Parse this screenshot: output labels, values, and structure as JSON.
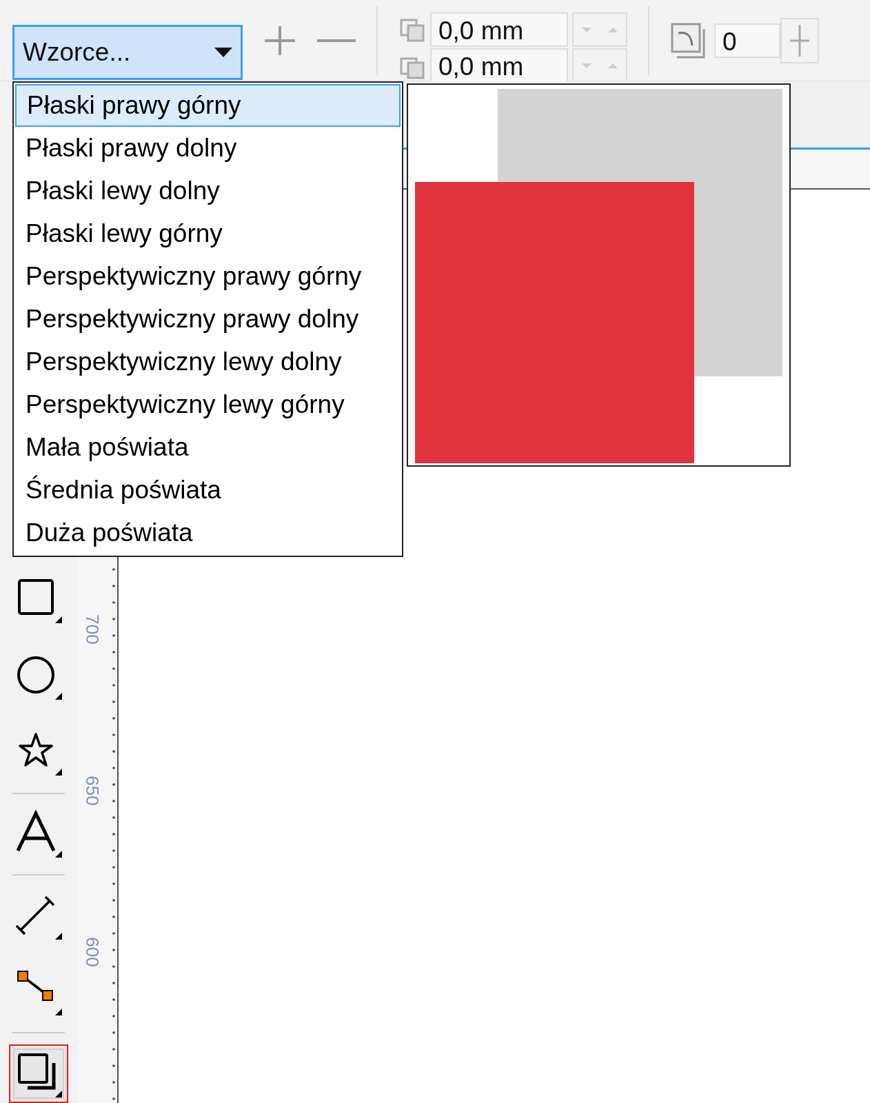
{
  "toolbar": {
    "preset_dropdown": {
      "label": "Wzorce..."
    },
    "offset_x": {
      "value": "0,0 mm"
    },
    "offset_y": {
      "value": "0,0 mm"
    },
    "angle": {
      "value": "0"
    }
  },
  "preset_list": [
    {
      "label": "Płaski prawy górny",
      "selected": true
    },
    {
      "label": "Płaski prawy dolny",
      "selected": false
    },
    {
      "label": "Płaski lewy dolny",
      "selected": false
    },
    {
      "label": "Płaski lewy górny",
      "selected": false
    },
    {
      "label": "Perspektywiczny prawy górny",
      "selected": false
    },
    {
      "label": "Perspektywiczny prawy dolny",
      "selected": false
    },
    {
      "label": "Perspektywiczny lewy dolny",
      "selected": false
    },
    {
      "label": "Perspektywiczny lewy górny",
      "selected": false
    },
    {
      "label": "Mała poświata",
      "selected": false
    },
    {
      "label": "Średnia poświata",
      "selected": false
    },
    {
      "label": "Duża poświata",
      "selected": false
    }
  ],
  "toolbox": [
    {
      "kind": "rectangle",
      "selected": false
    },
    {
      "kind": "ellipse",
      "selected": false
    },
    {
      "kind": "star",
      "selected": false
    },
    {
      "kind": "separator"
    },
    {
      "kind": "text",
      "selected": false
    },
    {
      "kind": "separator"
    },
    {
      "kind": "dimension",
      "selected": false
    },
    {
      "kind": "connector",
      "selected": false
    },
    {
      "kind": "separator"
    },
    {
      "kind": "shadow",
      "selected": true
    }
  ],
  "ruler_labels": [
    "700",
    "650",
    "600"
  ]
}
